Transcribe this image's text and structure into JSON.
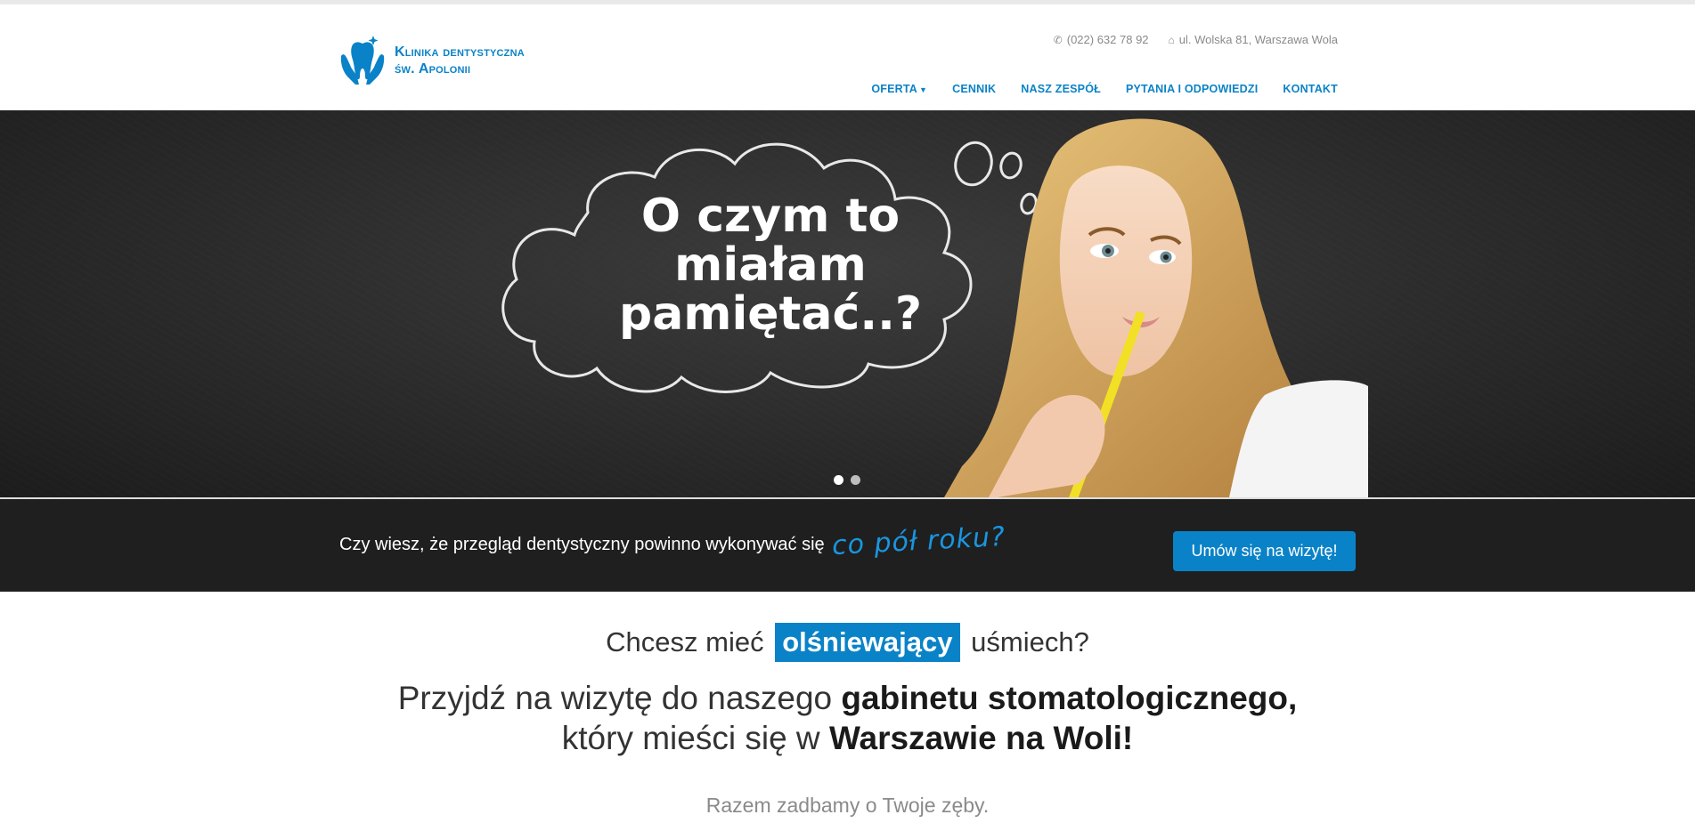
{
  "brand": {
    "line1": "Klinika dentystyczna",
    "line2": "św. Apolonii",
    "logo_icon": "tooth-hands-icon",
    "color": "#0a82c7"
  },
  "header": {
    "phone_icon": "phone-icon",
    "phone": "(022) 632 78 92",
    "address_icon": "home-icon",
    "address": "ul. Wolska 81, Warszawa Wola"
  },
  "nav": {
    "items": [
      {
        "label": "OFERTA"
      },
      {
        "label": "CENNIK"
      },
      {
        "label": "NASZ ZESPÓŁ"
      },
      {
        "label": "PYTANIA I ODPOWIEDZI"
      },
      {
        "label": "KONTAKT"
      }
    ],
    "dropdown_icon": "caret-down-icon"
  },
  "hero": {
    "headline": "O czym to miałam pamiętać..?",
    "slides": 2,
    "active_slide": 1
  },
  "band": {
    "text": "Czy wiesz, że przegląd dentystyczny powinno wykonywać się",
    "accent": "co pół roku?",
    "cta": "Umów się na wizytę!"
  },
  "intro": {
    "q_before": "Chcesz mieć",
    "q_highlight": "olśniewający",
    "q_after": "uśmiech?",
    "p1_a": "Przyjdź na wizytę do naszego",
    "p1_b": "gabinetu stomatologicznego,",
    "p1_c": "który mieści się w",
    "p1_d": "Warszawie na Woli!",
    "p2": "Razem zadbamy o Twoje zęby."
  }
}
